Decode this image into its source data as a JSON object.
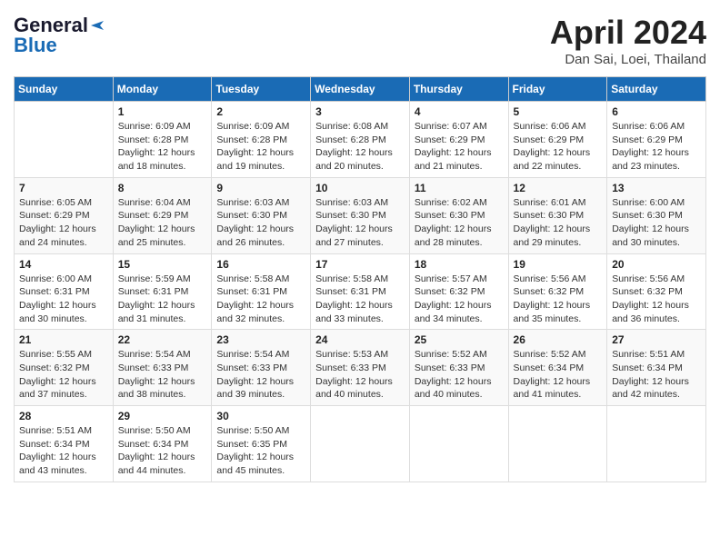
{
  "header": {
    "logo_general": "General",
    "logo_blue": "Blue",
    "month_title": "April 2024",
    "location": "Dan Sai, Loei, Thailand"
  },
  "calendar": {
    "days_of_week": [
      "Sunday",
      "Monday",
      "Tuesday",
      "Wednesday",
      "Thursday",
      "Friday",
      "Saturday"
    ],
    "weeks": [
      [
        {
          "day": "",
          "info": ""
        },
        {
          "day": "1",
          "info": "Sunrise: 6:09 AM\nSunset: 6:28 PM\nDaylight: 12 hours\nand 18 minutes."
        },
        {
          "day": "2",
          "info": "Sunrise: 6:09 AM\nSunset: 6:28 PM\nDaylight: 12 hours\nand 19 minutes."
        },
        {
          "day": "3",
          "info": "Sunrise: 6:08 AM\nSunset: 6:28 PM\nDaylight: 12 hours\nand 20 minutes."
        },
        {
          "day": "4",
          "info": "Sunrise: 6:07 AM\nSunset: 6:29 PM\nDaylight: 12 hours\nand 21 minutes."
        },
        {
          "day": "5",
          "info": "Sunrise: 6:06 AM\nSunset: 6:29 PM\nDaylight: 12 hours\nand 22 minutes."
        },
        {
          "day": "6",
          "info": "Sunrise: 6:06 AM\nSunset: 6:29 PM\nDaylight: 12 hours\nand 23 minutes."
        }
      ],
      [
        {
          "day": "7",
          "info": "Sunrise: 6:05 AM\nSunset: 6:29 PM\nDaylight: 12 hours\nand 24 minutes."
        },
        {
          "day": "8",
          "info": "Sunrise: 6:04 AM\nSunset: 6:29 PM\nDaylight: 12 hours\nand 25 minutes."
        },
        {
          "day": "9",
          "info": "Sunrise: 6:03 AM\nSunset: 6:30 PM\nDaylight: 12 hours\nand 26 minutes."
        },
        {
          "day": "10",
          "info": "Sunrise: 6:03 AM\nSunset: 6:30 PM\nDaylight: 12 hours\nand 27 minutes."
        },
        {
          "day": "11",
          "info": "Sunrise: 6:02 AM\nSunset: 6:30 PM\nDaylight: 12 hours\nand 28 minutes."
        },
        {
          "day": "12",
          "info": "Sunrise: 6:01 AM\nSunset: 6:30 PM\nDaylight: 12 hours\nand 29 minutes."
        },
        {
          "day": "13",
          "info": "Sunrise: 6:00 AM\nSunset: 6:30 PM\nDaylight: 12 hours\nand 30 minutes."
        }
      ],
      [
        {
          "day": "14",
          "info": "Sunrise: 6:00 AM\nSunset: 6:31 PM\nDaylight: 12 hours\nand 30 minutes."
        },
        {
          "day": "15",
          "info": "Sunrise: 5:59 AM\nSunset: 6:31 PM\nDaylight: 12 hours\nand 31 minutes."
        },
        {
          "day": "16",
          "info": "Sunrise: 5:58 AM\nSunset: 6:31 PM\nDaylight: 12 hours\nand 32 minutes."
        },
        {
          "day": "17",
          "info": "Sunrise: 5:58 AM\nSunset: 6:31 PM\nDaylight: 12 hours\nand 33 minutes."
        },
        {
          "day": "18",
          "info": "Sunrise: 5:57 AM\nSunset: 6:32 PM\nDaylight: 12 hours\nand 34 minutes."
        },
        {
          "day": "19",
          "info": "Sunrise: 5:56 AM\nSunset: 6:32 PM\nDaylight: 12 hours\nand 35 minutes."
        },
        {
          "day": "20",
          "info": "Sunrise: 5:56 AM\nSunset: 6:32 PM\nDaylight: 12 hours\nand 36 minutes."
        }
      ],
      [
        {
          "day": "21",
          "info": "Sunrise: 5:55 AM\nSunset: 6:32 PM\nDaylight: 12 hours\nand 37 minutes."
        },
        {
          "day": "22",
          "info": "Sunrise: 5:54 AM\nSunset: 6:33 PM\nDaylight: 12 hours\nand 38 minutes."
        },
        {
          "day": "23",
          "info": "Sunrise: 5:54 AM\nSunset: 6:33 PM\nDaylight: 12 hours\nand 39 minutes."
        },
        {
          "day": "24",
          "info": "Sunrise: 5:53 AM\nSunset: 6:33 PM\nDaylight: 12 hours\nand 40 minutes."
        },
        {
          "day": "25",
          "info": "Sunrise: 5:52 AM\nSunset: 6:33 PM\nDaylight: 12 hours\nand 40 minutes."
        },
        {
          "day": "26",
          "info": "Sunrise: 5:52 AM\nSunset: 6:34 PM\nDaylight: 12 hours\nand 41 minutes."
        },
        {
          "day": "27",
          "info": "Sunrise: 5:51 AM\nSunset: 6:34 PM\nDaylight: 12 hours\nand 42 minutes."
        }
      ],
      [
        {
          "day": "28",
          "info": "Sunrise: 5:51 AM\nSunset: 6:34 PM\nDaylight: 12 hours\nand 43 minutes."
        },
        {
          "day": "29",
          "info": "Sunrise: 5:50 AM\nSunset: 6:34 PM\nDaylight: 12 hours\nand 44 minutes."
        },
        {
          "day": "30",
          "info": "Sunrise: 5:50 AM\nSunset: 6:35 PM\nDaylight: 12 hours\nand 45 minutes."
        },
        {
          "day": "",
          "info": ""
        },
        {
          "day": "",
          "info": ""
        },
        {
          "day": "",
          "info": ""
        },
        {
          "day": "",
          "info": ""
        }
      ]
    ]
  }
}
